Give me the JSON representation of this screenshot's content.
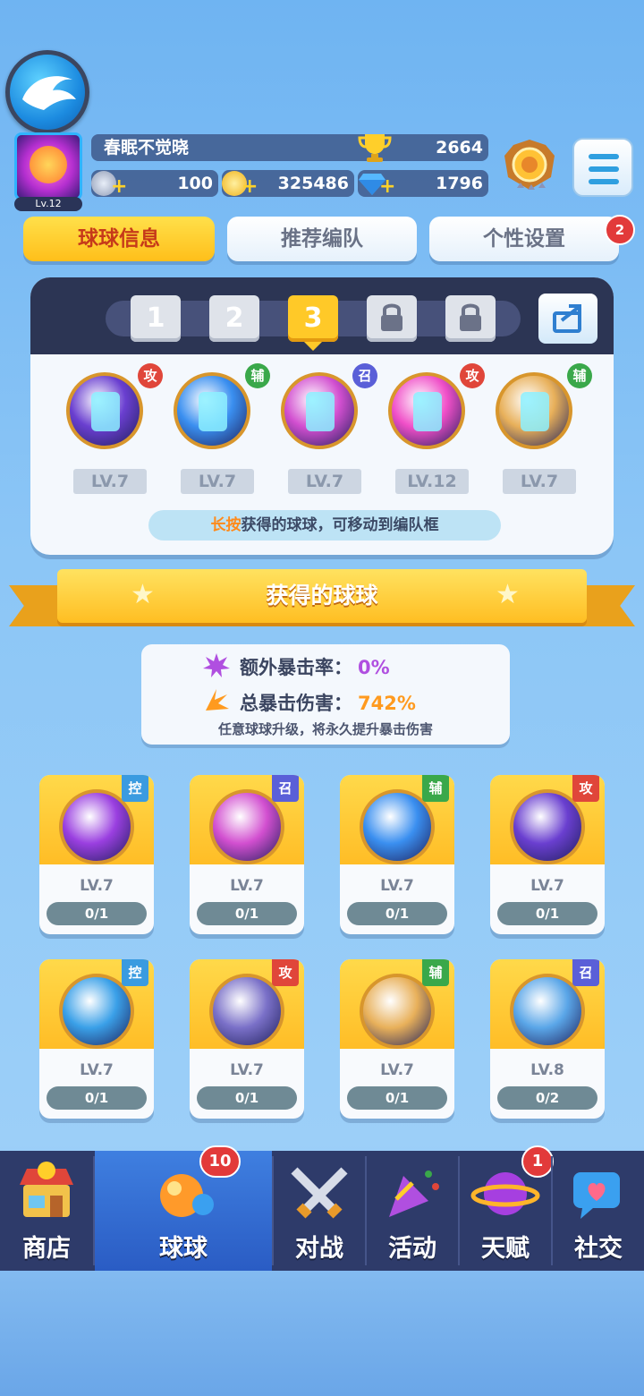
{
  "player": {
    "name": "春眠不觉晓",
    "level": "Lv.12",
    "trophies": "2664",
    "energy": "100",
    "gold": "325486",
    "gems": "1796"
  },
  "tabs": [
    {
      "label": "球球信息",
      "active": true
    },
    {
      "label": "推荐编队",
      "active": false
    },
    {
      "label": "个性设置",
      "active": false,
      "badge": "2"
    }
  ],
  "team": {
    "slots": [
      "1",
      "2",
      "3"
    ],
    "locked_slots": 2,
    "selected_slot": "3",
    "balls": [
      {
        "role": "攻",
        "level": "LV.7",
        "role_color": "#e0463a",
        "color": "#6a3fd0"
      },
      {
        "role": "辅",
        "level": "LV.7",
        "role_color": "#3aa84a",
        "color": "#3a8ff0"
      },
      {
        "role": "召",
        "level": "LV.7",
        "role_color": "#5a5fd8",
        "color": "#d24fd0"
      },
      {
        "role": "攻",
        "level": "LV.12",
        "role_color": "#e0463a",
        "color": "#f04fc8"
      },
      {
        "role": "辅",
        "level": "LV.7",
        "role_color": "#3aa84a",
        "color": "#e8b05a"
      }
    ],
    "hint_highlight": "长按",
    "hint_rest": "获得的球球，可移动到编队框"
  },
  "collection": {
    "title": "获得的球球",
    "crit_rate_label": "额外暴击率：",
    "crit_rate_value": "0%",
    "crit_damage_label": "总暴击伤害：",
    "crit_damage_value": "742%",
    "note": "任意球球升级，将永久提升暴击伤害",
    "cards": [
      {
        "tag": "控",
        "tag_color": "#3a9be0",
        "level": "LV.7",
        "count": "0/1",
        "color": "#9a3fe0"
      },
      {
        "tag": "召",
        "tag_color": "#5a5fd8",
        "level": "LV.7",
        "count": "0/1",
        "color": "#d24fd0"
      },
      {
        "tag": "辅",
        "tag_color": "#3aa84a",
        "level": "LV.7",
        "count": "0/1",
        "color": "#3a8ff0"
      },
      {
        "tag": "攻",
        "tag_color": "#e0463a",
        "level": "LV.7",
        "count": "0/1",
        "color": "#6a3fd0"
      },
      {
        "tag": "控",
        "tag_color": "#3a9be0",
        "level": "LV.7",
        "count": "0/1",
        "color": "#3aa0e8"
      },
      {
        "tag": "攻",
        "tag_color": "#e0463a",
        "level": "LV.7",
        "count": "0/1",
        "color": "#7a70c8"
      },
      {
        "tag": "辅",
        "tag_color": "#3aa84a",
        "level": "LV.7",
        "count": "0/1",
        "color": "#e8b05a"
      },
      {
        "tag": "召",
        "tag_color": "#5a5fd8",
        "level": "LV.8",
        "count": "0/2",
        "color": "#5aa6e8"
      }
    ]
  },
  "nav": [
    {
      "label": "商店",
      "icon": "shop-icon"
    },
    {
      "label": "球球",
      "icon": "ball-icon",
      "active": true,
      "badge": "10"
    },
    {
      "label": "对战",
      "icon": "swords-icon"
    },
    {
      "label": "活动",
      "icon": "party-icon"
    },
    {
      "label": "天赋",
      "icon": "planet-icon",
      "badge": "1"
    },
    {
      "label": "社交",
      "icon": "chat-icon"
    }
  ]
}
